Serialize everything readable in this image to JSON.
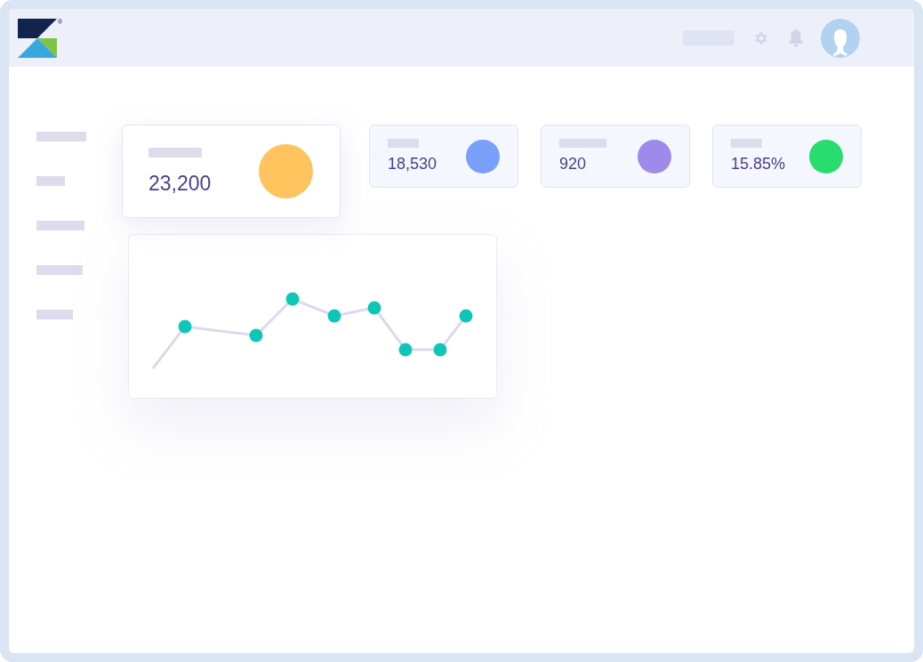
{
  "logo": {
    "registered_mark": "®"
  },
  "stat_cards": [
    {
      "kind": "large",
      "value": "23,200",
      "color": "#ffc45e"
    },
    {
      "kind": "small",
      "value": "18,530",
      "color": "#789ff9"
    },
    {
      "kind": "small",
      "value": "920",
      "color": "#9d8aeb"
    },
    {
      "kind": "small",
      "value": "15.85%",
      "color": "#28dd6e"
    }
  ]
}
